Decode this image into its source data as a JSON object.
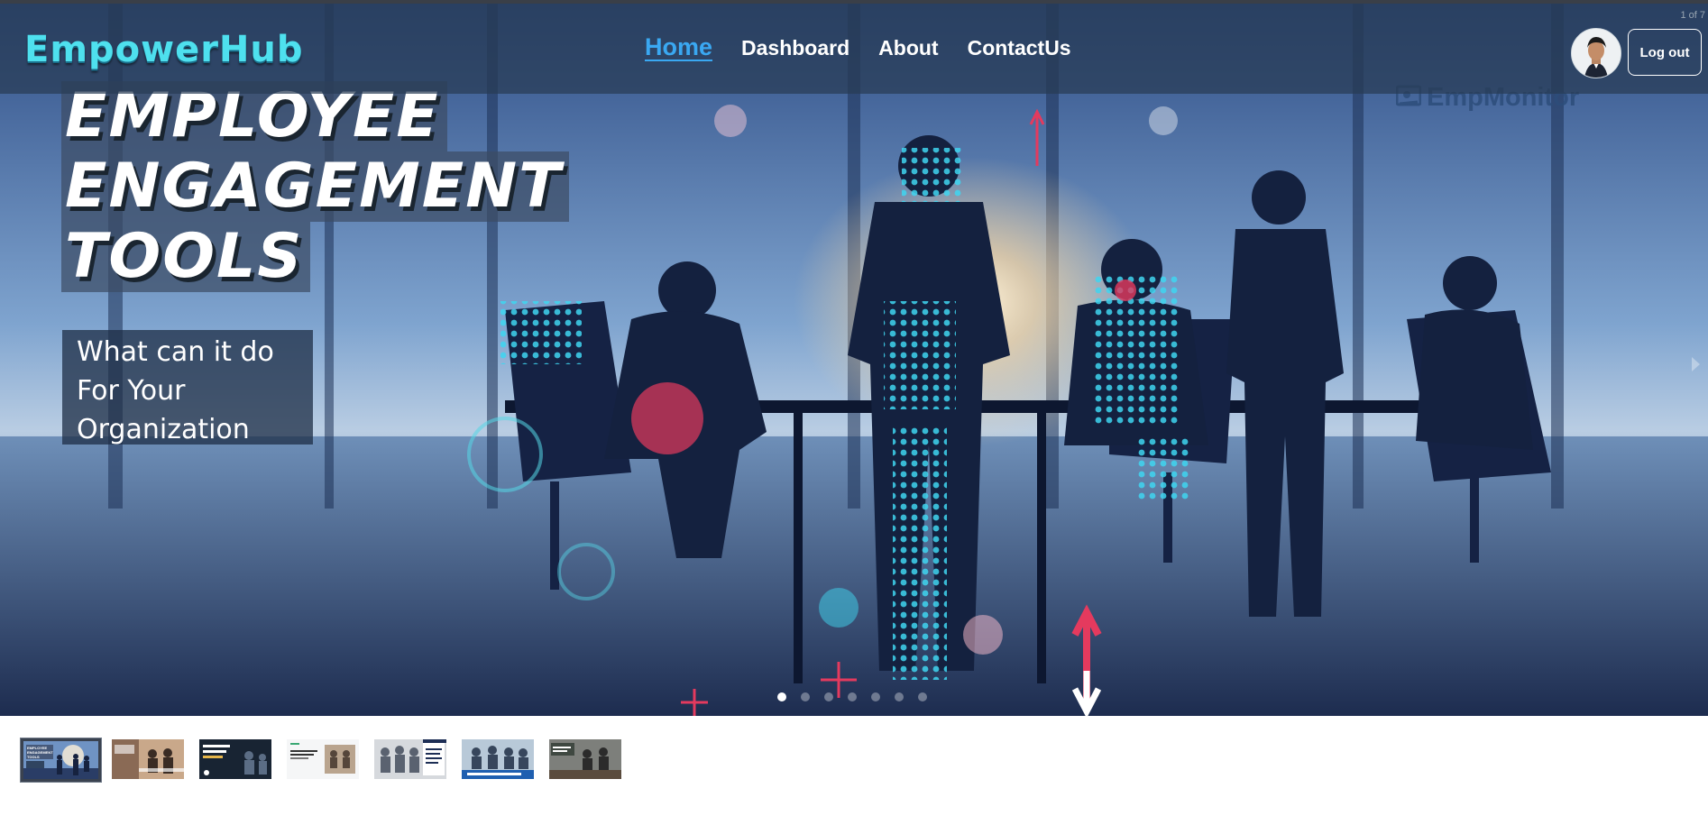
{
  "brand": "EmpowerHub",
  "nav": {
    "home": "Home",
    "dashboard": "Dashboard",
    "about": "About",
    "contact": "ContactUs"
  },
  "logout_label": "Log out",
  "slide_counter": "1 of 7",
  "slide": {
    "headline_lines": [
      "EMPLOYEE",
      "ENGAGEMENT",
      "TOOLS"
    ],
    "sub_lines": [
      "What can it do",
      "For Your",
      "Organization"
    ],
    "watermark": "EmpMonitor",
    "current": 1,
    "total": 7
  },
  "thumbnails": [
    {
      "theme": "office-meeting",
      "caption": "EMPLOYEE ENGAGEMENT TOOLS",
      "selected": true
    },
    {
      "theme": "warm-team",
      "caption": "",
      "selected": false
    },
    {
      "theme": "dark-navigating",
      "caption": "",
      "selected": false
    },
    {
      "theme": "white-article",
      "caption": "",
      "selected": false
    },
    {
      "theme": "grey-team",
      "caption": "",
      "selected": false
    },
    {
      "theme": "blue-team",
      "caption": "",
      "selected": false
    },
    {
      "theme": "meeting-table",
      "caption": "",
      "selected": false
    }
  ],
  "colors": {
    "brand": "#4ee0ee",
    "active_nav": "#3aa8f2",
    "navbar_bg": "#283c55"
  },
  "icons": {
    "avatar": "user-avatar",
    "next": "chevron-right-icon",
    "watermark_logo": "empmonitor-logo-icon"
  }
}
